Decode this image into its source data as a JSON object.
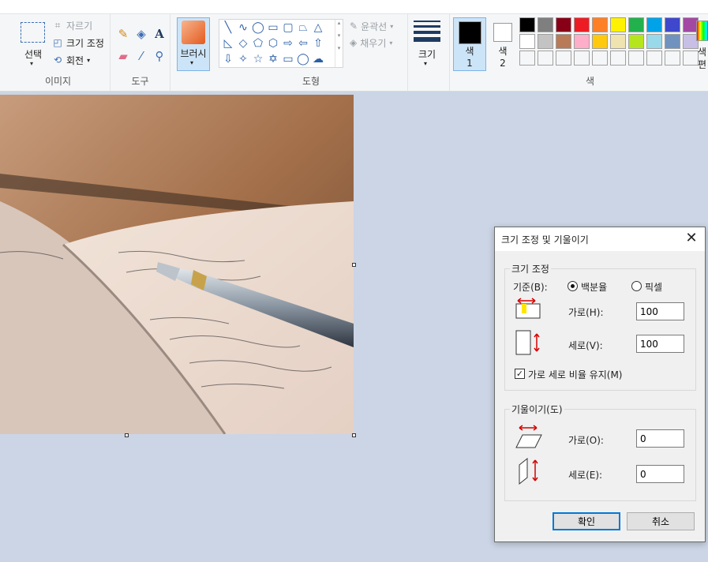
{
  "ribbon": {
    "image_group": {
      "select_label": "선택",
      "crop_label": "자르기",
      "resize_label": "크기 조정",
      "rotate_label": "회전",
      "group_label": "이미지"
    },
    "tools_group": {
      "group_label": "도구"
    },
    "brush_label": "브러시",
    "shapes_group": {
      "outline_label": "윤곽선",
      "fill_label": "채우기",
      "group_label": "도형"
    },
    "size_label": "크기",
    "color1_label": "색\n1",
    "color2_label": "색\n2",
    "colors_group_label": "색",
    "edit_colors_label": "색\n편",
    "palette": [
      "#000000",
      "#7f7f7f",
      "#880015",
      "#ed1c24",
      "#ff7f27",
      "#fff200",
      "#22b14c",
      "#00a2e8",
      "#3f48cc",
      "#a349a4",
      "#ffffff",
      "#c3c3c3",
      "#b97a57",
      "#ffaec9",
      "#ffc90e",
      "#efe4b0",
      "#b5e61d",
      "#99d9ea",
      "#7092be",
      "#c8bfe7",
      "#f5f6f7",
      "#f5f6f7",
      "#f5f6f7",
      "#f5f6f7",
      "#f5f6f7",
      "#f5f6f7",
      "#f5f6f7",
      "#f5f6f7",
      "#f5f6f7",
      "#f5f6f7"
    ]
  },
  "dialog": {
    "title": "크기 조정 및 기울이기",
    "resize_legend": "크기 조정",
    "basis_label": "기준(B):",
    "percent_label": "백분율",
    "pixel_label": "픽셀",
    "horizontal_label": "가로(H):",
    "horizontal_value": "100",
    "vertical_label": "세로(V):",
    "vertical_value": "100",
    "keep_ratio_label": "가로 세로 비율 유지(M)",
    "skew_legend": "기울이기(도)",
    "skew_h_label": "가로(O):",
    "skew_h_value": "0",
    "skew_v_label": "세로(E):",
    "skew_v_value": "0",
    "ok_label": "확인",
    "cancel_label": "취소"
  }
}
